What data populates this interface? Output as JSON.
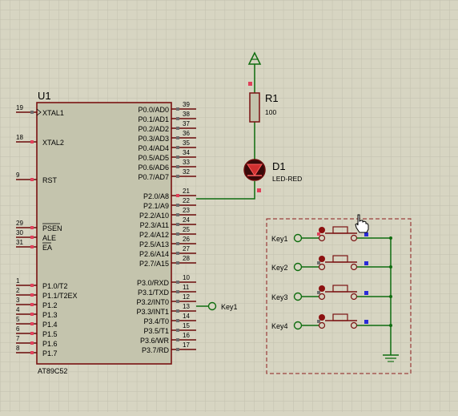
{
  "colors": {
    "background": "#d7d5c2",
    "grid": "#c2c0ad",
    "wire": "#0f6d0f",
    "body_outline": "#7a1212",
    "body_fill": "#c4c4ad",
    "pin": "#6b0b0b",
    "pin_marker": "#e0405a",
    "pin_marker_dark": "#6f6f6f",
    "text": "#000000",
    "frame": "#8c1c1c",
    "blue_marker": "#2a2ad8"
  },
  "mcu": {
    "ref": "U1",
    "part": "AT89C52",
    "left_pins": [
      {
        "num": "19",
        "name": "XTAL1"
      },
      {
        "num": "18",
        "name": "XTAL2"
      },
      {
        "num": "9",
        "name": "RST"
      },
      {
        "num": "29",
        "name": "PSEN"
      },
      {
        "num": "30",
        "name": "ALE"
      },
      {
        "num": "31",
        "name": "EA"
      },
      {
        "num": "1",
        "name": "P1.0/T2"
      },
      {
        "num": "2",
        "name": "P1.1/T2EX"
      },
      {
        "num": "3",
        "name": "P1.2"
      },
      {
        "num": "4",
        "name": "P1.3"
      },
      {
        "num": "5",
        "name": "P1.4"
      },
      {
        "num": "6",
        "name": "P1.5"
      },
      {
        "num": "7",
        "name": "P1.6"
      },
      {
        "num": "8",
        "name": "P1.7"
      }
    ],
    "right_pins": [
      {
        "num": "39",
        "name": "P0.0/AD0"
      },
      {
        "num": "38",
        "name": "P0.1/AD1"
      },
      {
        "num": "37",
        "name": "P0.2/AD2"
      },
      {
        "num": "36",
        "name": "P0.3/AD3"
      },
      {
        "num": "35",
        "name": "P0.4/AD4"
      },
      {
        "num": "34",
        "name": "P0.5/AD5"
      },
      {
        "num": "33",
        "name": "P0.6/AD6"
      },
      {
        "num": "32",
        "name": "P0.7/AD7"
      },
      {
        "num": "21",
        "name": "P2.0/A8"
      },
      {
        "num": "22",
        "name": "P2.1/A9"
      },
      {
        "num": "23",
        "name": "P2.2/A10"
      },
      {
        "num": "24",
        "name": "P2.3/A11"
      },
      {
        "num": "25",
        "name": "P2.4/A12"
      },
      {
        "num": "26",
        "name": "P2.5/A13"
      },
      {
        "num": "27",
        "name": "P2.6/A14"
      },
      {
        "num": "28",
        "name": "P2.7/A15"
      },
      {
        "num": "10",
        "name": "P3.0/RXD"
      },
      {
        "num": "11",
        "name": "P3.1/TXD"
      },
      {
        "num": "12",
        "name": "P3.2/INT0"
      },
      {
        "num": "13",
        "name": "P3.3/INT1"
      },
      {
        "num": "14",
        "name": "P3.4/T0"
      },
      {
        "num": "15",
        "name": "P3.5/T1"
      },
      {
        "num": "16",
        "name": "P3.6/WR"
      },
      {
        "num": "17",
        "name": "P3.7/RD"
      }
    ]
  },
  "resistor": {
    "ref": "R1",
    "value": "100"
  },
  "led": {
    "ref": "D1",
    "value": "LED-RED"
  },
  "net_label": "Key1",
  "keys": [
    "Key1",
    "Key2",
    "Key3",
    "Key4"
  ]
}
